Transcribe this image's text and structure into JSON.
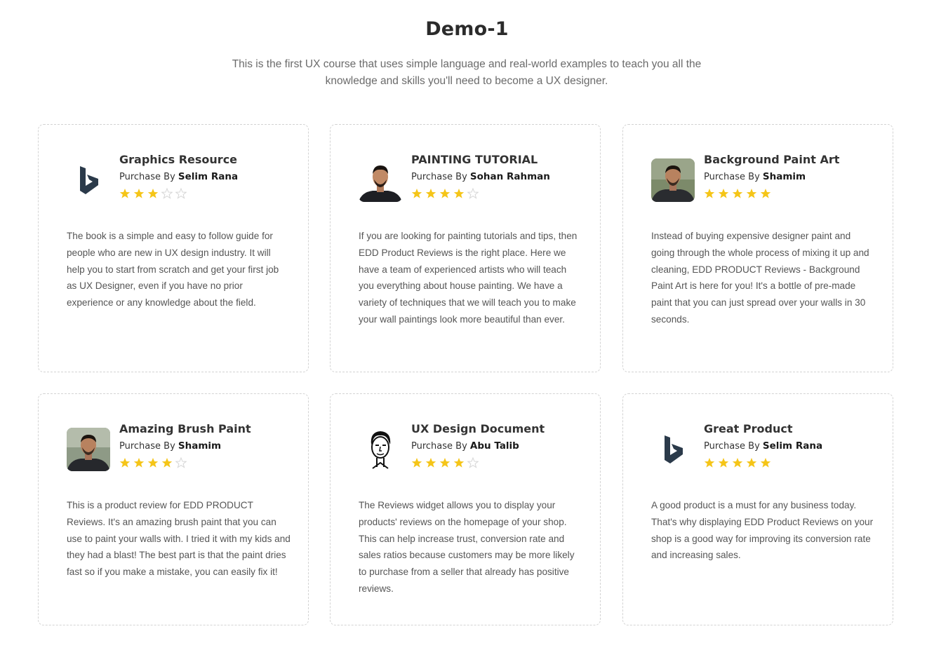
{
  "header": {
    "title": "Demo-1",
    "subtitle": "This is the first UX course that uses simple language and real-world examples to teach you all the knowledge and skills you'll need to become a UX designer."
  },
  "purchase_prefix": "Purchase By",
  "colors": {
    "star_filled": "#f5c518",
    "star_empty": "#d6d6d6",
    "logo": "#2b3a4a"
  },
  "cards": [
    {
      "title": "Graphics Resource",
      "purchaser": "Selim Rana",
      "rating": 3,
      "avatar": "bing-logo-icon",
      "text": "The book is a simple and easy to follow guide for people who are new in UX design industry. It will help you to start from scratch and get your first job as UX Designer, even if you have no prior experience or any knowledge about the field."
    },
    {
      "title": "PAINTING TUTORIAL",
      "purchaser": "Sohan Rahman",
      "rating": 4,
      "avatar": "person-photo",
      "text": "If you are looking for painting tutorials and tips, then EDD Product Reviews is the right place. Here we have a team of experienced artists who will teach you everything about house painting. We have a variety of techniques that we will teach you to make your wall paintings look more beautiful than ever."
    },
    {
      "title": "Background Paint Art",
      "purchaser": "Shamim",
      "rating": 5,
      "avatar": "person-photo",
      "text": "Instead of buying expensive designer paint and going through the whole process of mixing it up and cleaning, EDD PRODUCT Reviews - Background Paint Art is here for you! It's a bottle of pre-made paint that you can just spread over your walls in 30 seconds."
    },
    {
      "title": "Amazing Brush Paint",
      "purchaser": "Shamim",
      "rating": 4,
      "avatar": "person-photo",
      "text": "This is a product review for EDD PRODUCT Reviews. It's an amazing brush paint that you can use to paint your walls with. I tried it with my kids and they had a blast! The best part is that the paint dries fast so if you make a mistake, you can easily fix it!"
    },
    {
      "title": "UX Design Document",
      "purchaser": "Abu Talib",
      "rating": 4,
      "avatar": "sketch-portrait",
      "text": "The Reviews widget allows you to display your products' reviews on the homepage of your shop. This can help increase trust, conversion rate and sales ratios because customers may be more likely to purchase from a seller that already has positive reviews."
    },
    {
      "title": "Great Product",
      "purchaser": "Selim Rana",
      "rating": 5,
      "avatar": "bing-logo-icon",
      "text": "A good product is a must for any business today. That's why displaying EDD Product Reviews on your shop is a good way for improving its conversion rate and increasing sales."
    }
  ]
}
